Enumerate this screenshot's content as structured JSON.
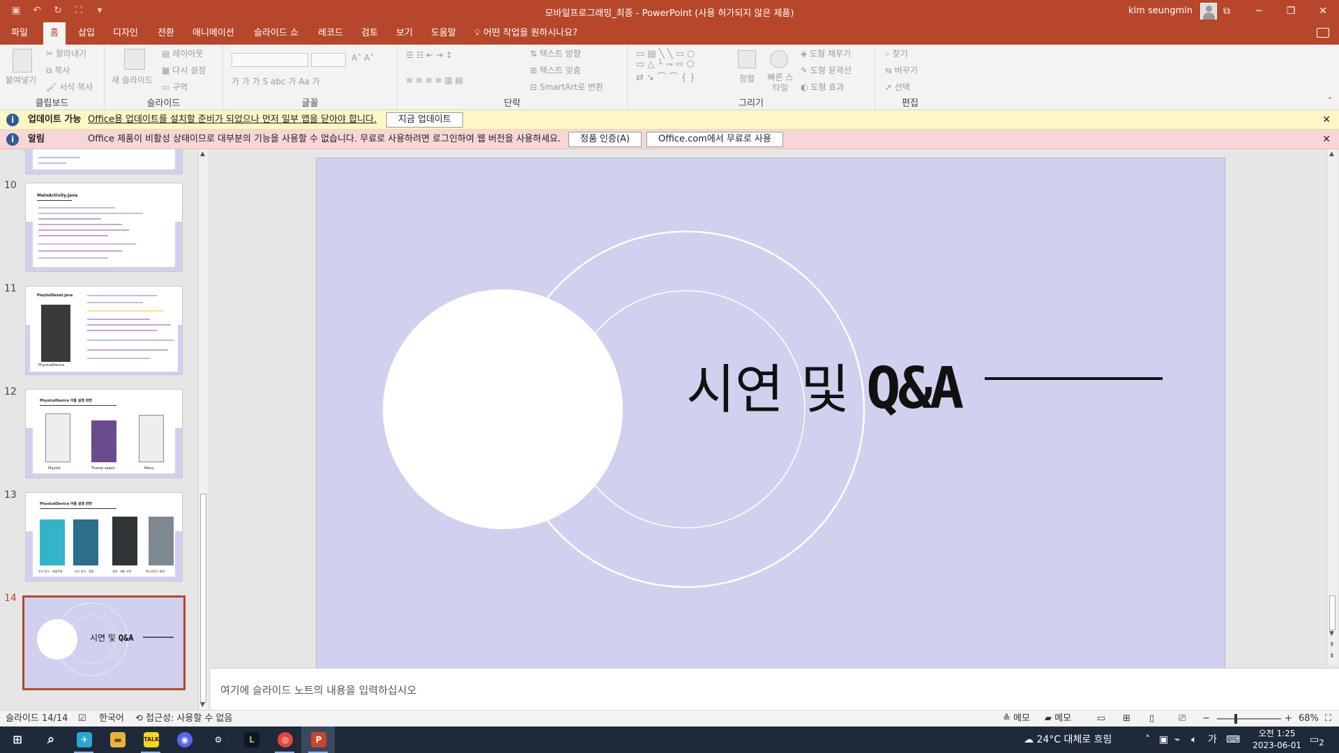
{
  "window": {
    "title": "모바일프로그래밍_최종  -  PowerPoint (사용 허가되지 않은 제품)",
    "user": "kim seungmin",
    "controls": [
      "⧉",
      "─",
      "❐",
      "✕"
    ]
  },
  "menu": {
    "tabs": [
      "파일",
      "홈",
      "삽입",
      "디자인",
      "전환",
      "애니메이션",
      "슬라이드 쇼",
      "레코드",
      "검토",
      "보기",
      "도움말"
    ],
    "active_tab": "홈",
    "tell_me": "어떤 작업을 원하시나요?"
  },
  "ribbon": {
    "clipboard": {
      "label": "클립보드",
      "paste": "붙여넣기",
      "cut": "잘라내기",
      "copy": "복사",
      "format_painter": "서식 복사"
    },
    "slides": {
      "label": "슬라이드",
      "new_slide": "새 슬라이드",
      "layout": "레이아웃",
      "reset": "다시 설정",
      "section": "구역"
    },
    "font": {
      "label": "글꼴"
    },
    "paragraph": {
      "label": "단락",
      "text_direction": "텍스트 방향",
      "align_text": "텍스트 맞춤",
      "smartart": "SmartArt로 변환"
    },
    "drawing": {
      "label": "그리기",
      "arrange": "정렬",
      "quick_styles": "빠른 스타일",
      "shape_fill": "도형 채우기",
      "shape_outline": "도형 윤곽선",
      "shape_effects": "도형 효과"
    },
    "editing": {
      "label": "편집",
      "find": "찾기",
      "replace": "바꾸기",
      "select": "선택"
    }
  },
  "notifications": {
    "update": {
      "title": "업데이트 가능",
      "message": "Office용 업데이트를 설치할 준비가 되었으나 먼저 일부 앱을 닫아야 합니다.",
      "button": "지금 업데이트"
    },
    "alert": {
      "title": "알림",
      "message": "Office 제품이 비활성 상태이므로 대부분의 기능을 사용할 수 없습니다. 무료로 사용하려면 로그인하여 웹 버전을 사용하세요.",
      "button1": "정품 인증(A)",
      "button2": "Office.com에서 무료로 사용"
    }
  },
  "thumbnails": [
    {
      "number": "10",
      "title": "MainActivity.Java"
    },
    {
      "number": "11",
      "title": "PlaylistDetail.Java",
      "caption": "PhysicalDevice"
    },
    {
      "number": "12",
      "title": "PhysicalDevice 어플 실행 화면",
      "captions": [
        "Playlist",
        "Theme select",
        "Menu"
      ]
    },
    {
      "number": "13",
      "title": "PhysicalDevice 어플 실행 화면",
      "captions": [
        "보기 방식 - 재생목록",
        "보기 방식 - 앨범",
        "설정 - 테마 선택",
        "백그라운드 화면"
      ]
    },
    {
      "number": "14",
      "title": "시연 및 Q&A",
      "selected": true
    }
  ],
  "slide": {
    "title_korean": "시연 및 ",
    "title_latin": "Q&A",
    "background": "#cfd1ee"
  },
  "notes_placeholder": "여기에 슬라이드 노트의 내용을 입력하십시오",
  "status": {
    "slide_counter": "슬라이드 14/14",
    "language": "한국어",
    "accessibility": "접근성: 사용할 수 없음",
    "notes": "메모",
    "comments": "메모",
    "zoom": "68%"
  },
  "taskbar": {
    "weather": "24°C  대체로 흐림",
    "ime": "가",
    "time": "오전 1:25",
    "date": "2023-06-01",
    "notification_count": "2"
  },
  "colors": {
    "accent": "#b7472a",
    "update_bar": "#fdf6c5",
    "alert_bar": "#f9d6d6"
  }
}
